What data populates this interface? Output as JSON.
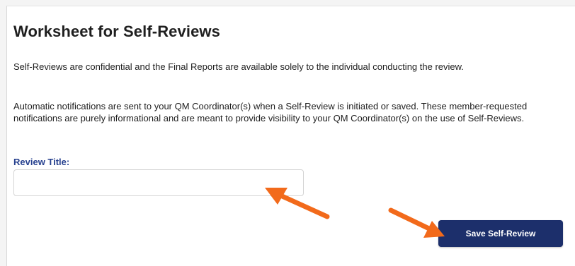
{
  "worksheet": {
    "title": "Worksheet for Self-Reviews",
    "paragraph_1": "Self-Reviews are confidential and the Final Reports are available solely to the individual conducting the review.",
    "paragraph_2": "Automatic notifications are sent to your QM Coordinator(s) when a Self-Review is initiated or saved. These member-requested notifications are purely informational and are meant to provide visibility to your QM Coordinator(s) on the use of Self-Reviews.",
    "review_title_label": "Review Title:",
    "review_title_value": "",
    "review_title_placeholder": "",
    "save_button_label": "Save Self-Review"
  },
  "annotations": {
    "arrow_color": "#f26a1b",
    "arrows": [
      "arrow-icon",
      "arrow-icon"
    ]
  },
  "colors": {
    "label_blue": "#27418f",
    "button_navy": "#1c2f6b"
  }
}
